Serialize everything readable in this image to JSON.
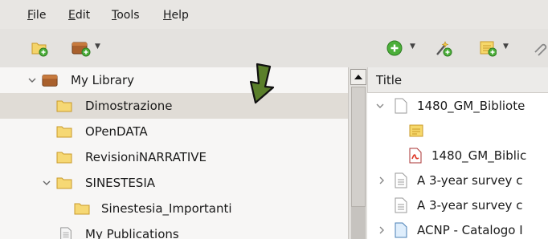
{
  "menubar": {
    "items": [
      {
        "label": "File",
        "underline": "F",
        "rest": "ile"
      },
      {
        "label": "Edit",
        "underline": "E",
        "rest": "dit"
      },
      {
        "label": "Tools",
        "underline": "T",
        "rest": "ools"
      },
      {
        "label": "Help",
        "underline": "H",
        "rest": "elp"
      }
    ]
  },
  "toolbar": {
    "icons": [
      "new-collection-icon",
      "new-library-icon",
      "new-item-icon",
      "add-by-identifier-icon",
      "new-note-icon",
      "attachment-icon"
    ]
  },
  "library": {
    "root_label": "My Library",
    "items": [
      {
        "label": "Dimostrazione",
        "selected": true
      },
      {
        "label": "OPenDATA",
        "selected": false
      },
      {
        "label": "RevisioniNARRATIVE",
        "selected": false
      },
      {
        "label": "SINESTESIA",
        "selected": false,
        "expanded": true
      },
      {
        "label": "Sinestesia_Importanti",
        "selected": false,
        "child": true
      },
      {
        "label": "My Publications",
        "selected": false
      }
    ]
  },
  "items_pane": {
    "column_title": "Title",
    "rows": [
      {
        "label": "1480_GM_Bibliote",
        "kind": "document",
        "twisty": "expanded"
      },
      {
        "label": "",
        "kind": "note"
      },
      {
        "label": "1480_GM_Biblic",
        "kind": "pdf"
      },
      {
        "label": "A 3-year survey c",
        "kind": "document",
        "twisty": "collapsed"
      },
      {
        "label": "A 3-year survey c",
        "kind": "document"
      },
      {
        "label": "ACNP - Catalogo I",
        "kind": "webpage",
        "twisty": "collapsed"
      }
    ]
  },
  "colors": {
    "folder": "#f2c94c",
    "selected_row": "#e0dcd6",
    "annotation_arrow": "#5a7f2a"
  }
}
